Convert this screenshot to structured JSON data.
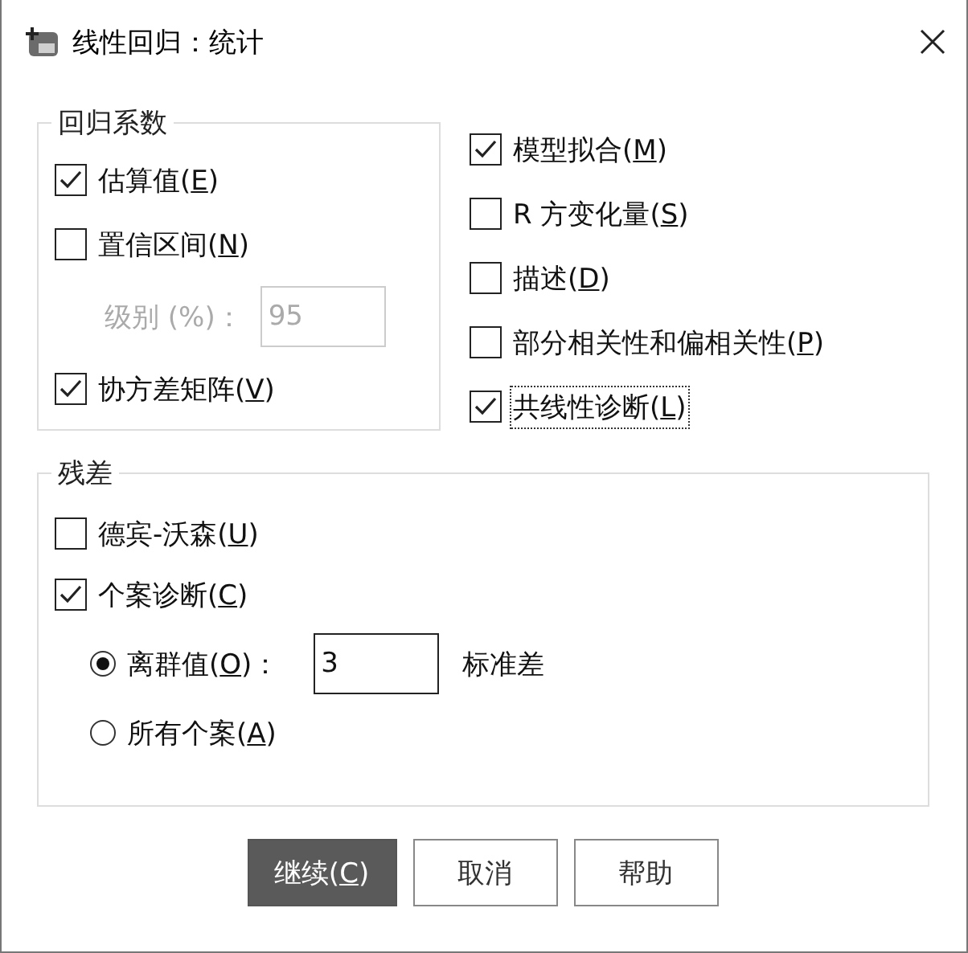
{
  "window": {
    "title": "线性回归：统计"
  },
  "coefficients": {
    "title": "回归系数",
    "items": [
      {
        "kind": "checkbox",
        "label": "估算值(",
        "key": "E",
        "tail": ")",
        "checked": true
      },
      {
        "kind": "checkbox",
        "label": "置信区间(",
        "key": "N",
        "tail": ")",
        "checked": false
      },
      {
        "kind": "field",
        "label": "级别 (%)：",
        "value": "95",
        "disabled": true
      },
      {
        "kind": "checkbox",
        "label": "协方差矩阵(",
        "key": "V",
        "tail": ")",
        "checked": true
      }
    ]
  },
  "options": [
    {
      "label": "模型拟合(",
      "key": "M",
      "tail": ")",
      "checked": true,
      "focused": false
    },
    {
      "label": "R 方变化量(",
      "key": "S",
      "tail": ")",
      "checked": false,
      "focused": false
    },
    {
      "label": "描述(",
      "key": "D",
      "tail": ")",
      "checked": false,
      "focused": false
    },
    {
      "label": "部分相关性和偏相关性(",
      "key": "P",
      "tail": ")",
      "checked": false,
      "focused": false
    },
    {
      "label": "共线性诊断(",
      "key": "L",
      "tail": ")",
      "checked": true,
      "focused": true
    }
  ],
  "residuals": {
    "title": "残差",
    "items": [
      {
        "kind": "checkbox",
        "label": "德宾-沃森(",
        "key": "U",
        "tail": ")",
        "checked": false
      },
      {
        "kind": "checkbox",
        "label": "个案诊断(",
        "key": "C",
        "tail": ")",
        "checked": true
      },
      {
        "kind": "radio",
        "label": "离群值(",
        "key": "O",
        "tail": ")：",
        "selected": true,
        "value": "3",
        "unit": "标准差"
      },
      {
        "kind": "radio",
        "label": "所有个案(",
        "key": "A",
        "tail": ")",
        "selected": false
      }
    ]
  },
  "buttons": [
    {
      "label": "继续(",
      "key": "C",
      "tail": ")",
      "default": true
    },
    {
      "label": "取消",
      "default": false
    },
    {
      "label": "帮助",
      "default": false
    }
  ]
}
